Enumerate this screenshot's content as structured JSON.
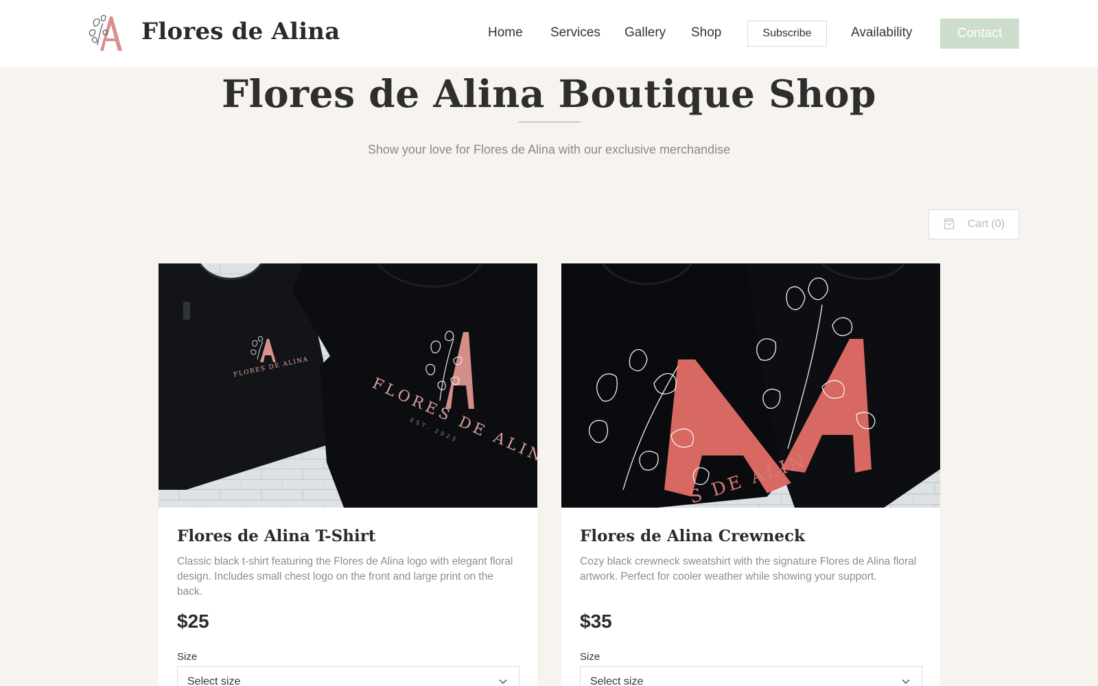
{
  "brand": {
    "name": "Flores de Alina",
    "accent": "#cf7c7a",
    "logo_icon": "floral-monogram-a"
  },
  "nav": {
    "items": [
      {
        "label": "Home"
      },
      {
        "label": "Services"
      },
      {
        "label": "Gallery"
      },
      {
        "label": "Shop"
      }
    ],
    "subscribe_label": "Subscribe",
    "availability_label": "Availability",
    "contact_label": "Contact",
    "contact_color": "#cdddcc"
  },
  "hero": {
    "title": "Flores de Alina Boutique Shop",
    "subtitle": "Show your love for Flores de Alina with our exclusive merchandise"
  },
  "cart": {
    "label": "Cart (0)",
    "icon": "shopping-bag-icon"
  },
  "products": [
    {
      "title": "Flores de Alina T-Shirt",
      "description": "Classic black t-shirt featuring the Flores de Alina logo with elegant floral design. Includes small chest logo on the front and large print on the back.",
      "price": "$25",
      "size_label": "Size",
      "size_value": "Select size",
      "image_text": [
        "FLORES DE ALINA",
        "EST. 2023"
      ]
    },
    {
      "title": "Flores de Alina Crewneck",
      "description": "Cozy black crewneck sweatshirt with the signature Flores de Alina floral artwork. Perfect for cooler weather while showing your support.",
      "price": "$35",
      "size_label": "Size",
      "size_value": "Select size",
      "image_text": [
        "S DE ALIN"
      ]
    }
  ]
}
